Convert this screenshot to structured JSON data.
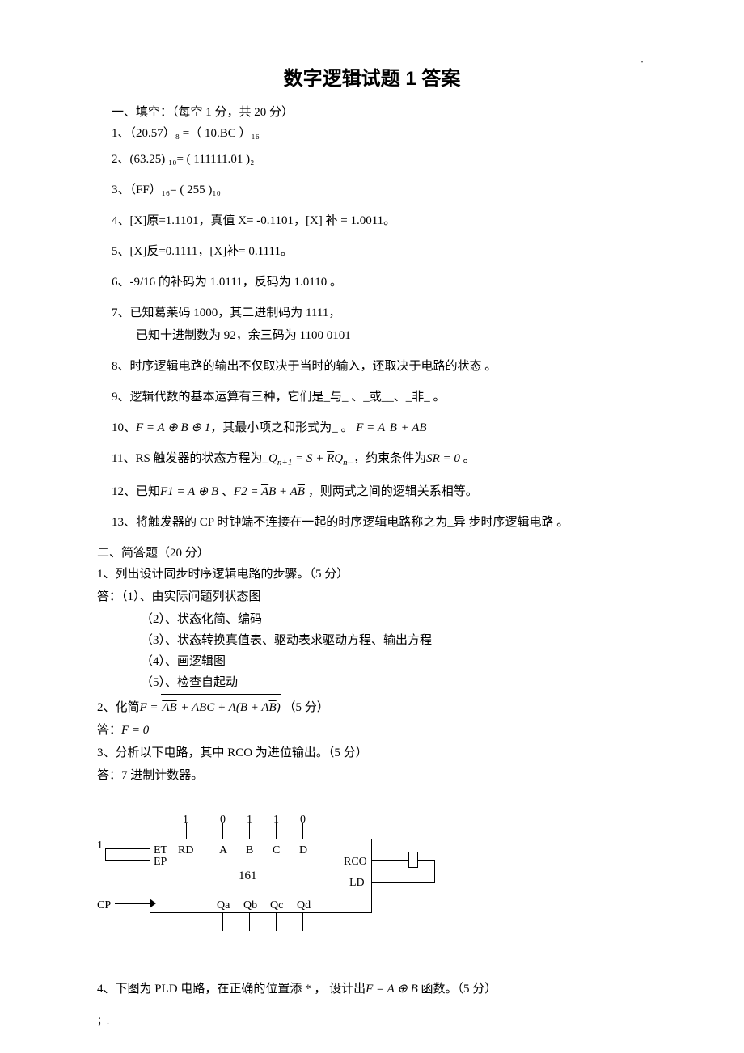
{
  "top_dot": "﹒",
  "title": "数字逻辑试题 1 答案",
  "sec1": {
    "head": "一、填空：（每空 1 分，共 20 分）",
    "q1": "1、（20.57）₈ =（ 10.BC    ）₁₆",
    "q2": "2、(63.25) ₁₀= ( 111111.01    )₂",
    "q3": "3、（FF）₁₆= ( 255 )₁₀",
    "q4": "4、[X]原=1.1101，真值 X= -0.1101，[X] 补 = 1.0011。",
    "q5": "5、[X]反=0.1111，[X]补= 0.1111。",
    "q6": "6、-9/16 的补码为 1.0111，反码为 1.0110 。",
    "q7a": "7、已知葛莱码 1000，其二进制码为 1111，",
    "q7b": "已知十进制数为 92，余三码为 1100 0101",
    "q8": "8、时序逻辑电路的输出不仅取决于当时的输入，还取决于电路的状态 。",
    "q9": "9、逻辑代数的基本运算有三种，它们是_与_ 、_或__、_非_ 。",
    "q10_pre": "10、",
    "q10_eq1": "F = A ⊕ B ⊕ 1",
    "q10_mid": "，其最小项之和形式为_ 。",
    "q10_eq2_pre": "F = ",
    "q10_eq2_ab1": "A B",
    "q10_eq2_plus": " + AB",
    "q11_pre": "11、RS 触发器的状态方程为_",
    "q11_q": "Q",
    "q11_n1": "n+1",
    "q11_eq": " = S + ",
    "q11_r": "R",
    "q11_qn": "Q",
    "q11_n": "n",
    "q11_mid": "_，约束条件为",
    "q11_sr": "SR = 0",
    "q11_end": " 。",
    "q12_pre": "12、已知",
    "q12_f1": "F1 = A ⊕ B",
    "q12_dot": " 、",
    "q12_f2pre": "F2 = ",
    "q12_a": "A",
    "q12_b": "B + A",
    "q12_b2": "B",
    "q12_end": " ，则两式之间的逻辑关系相等。",
    "q13": "13、将触发器的 CP 时钟端不连接在一起的时序逻辑电路称之为_异  步时序逻辑电路 。"
  },
  "sec2": {
    "head": "二、简答题（20 分）",
    "q1": "1、列出设计同步时序逻辑电路的步骤。（5 分）",
    "a1_head": "答：（1）、由实际问题列状态图",
    "a1_2": "（2）、状态化简、编码",
    "a1_3": "（3）、状态转换真值表、驱动表求驱动方程、输出方程",
    "a1_4": "（4）、画逻辑图",
    "a1_5": "（5）、检查自起动",
    "q2_pre": "2、化简",
    "q2_f": "F = ",
    "q2_term1_inner": "AB",
    "q2_plus1": " + ABC + A(B + A",
    "q2_b": "B",
    "q2_close": ")",
    "q2_pts": "（5 分）",
    "q2_ans": "答：",
    "q2_ans_eq": "F = 0",
    "q3": "3、分析以下电路，其中 RCO 为进位输出。（5 分）",
    "q3_ans": "答：7 进制计数器。",
    "q4_pre": "4、下图为 PLD 电路，在正确的位置添 * ，  设计出",
    "q4_f": "F = A ⊕ B",
    "q4_end": " 函数。（5 分）"
  },
  "diagram": {
    "one": "1",
    "zero": "0",
    "ep": "EP",
    "et": "ET",
    "rd": "RD",
    "a": "A",
    "b": "B",
    "c": "C",
    "d": "D",
    "chip": "161",
    "rco": "RCO",
    "ld": "LD",
    "cp": "CP",
    "qa": "Qa",
    "qb": "Qb",
    "qc": "Qc",
    "qd": "Qd"
  },
  "footer": "；."
}
